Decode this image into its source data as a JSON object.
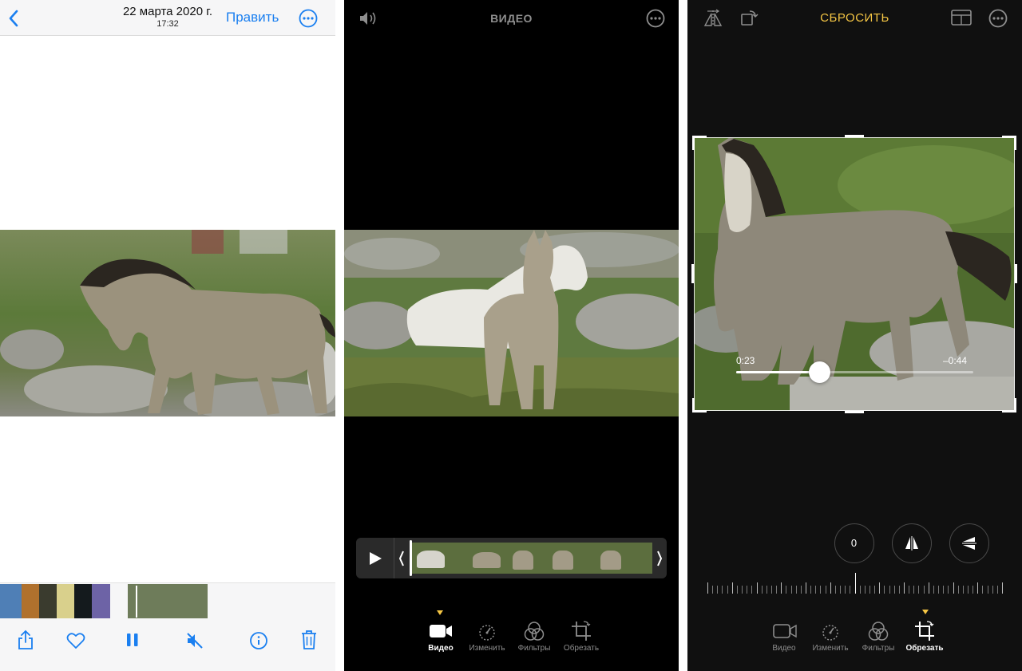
{
  "panel1": {
    "header": {
      "back_icon": "chevron-left-icon",
      "date": "22 марта 2020 г.",
      "time": "17:32",
      "edit_label": "Править",
      "more_icon": "ellipsis-circle-icon"
    },
    "toolbar": {
      "icons": [
        "share-icon",
        "heart-icon",
        "pause-icon",
        "speaker-mute-icon",
        "info-icon",
        "trash-icon"
      ]
    },
    "accent_color": "#1a7ff0"
  },
  "panel2": {
    "header": {
      "sound_icon": "speaker-icon",
      "title": "ВИДЕО",
      "more_icon": "ellipsis-circle-icon"
    },
    "timeline": {
      "play_icon": "play-icon"
    },
    "tabs": [
      {
        "label": "Видео",
        "icon": "video-camera-icon",
        "active": true
      },
      {
        "label": "Изменить",
        "icon": "adjust-dial-icon",
        "active": false
      },
      {
        "label": "Фильтры",
        "icon": "filters-icon",
        "active": false
      },
      {
        "label": "Обрезать",
        "icon": "crop-icon",
        "active": false
      }
    ]
  },
  "panel3": {
    "header": {
      "flip_icon": "flip-horizontal-icon",
      "rotate_icon": "rotate-icon",
      "reset_label": "СБРОСИТЬ",
      "aspect_icon": "aspect-ratio-icon",
      "more_icon": "ellipsis-circle-icon"
    },
    "scrubber": {
      "elapsed": "0:23",
      "remaining": "–0:44",
      "progress": 0.35
    },
    "straighten": {
      "value": "0"
    },
    "perspective_icons": [
      "vertical-perspective-icon",
      "horizontal-perspective-icon"
    ],
    "tabs": [
      {
        "label": "Видео",
        "icon": "video-camera-icon",
        "active": false
      },
      {
        "label": "Изменить",
        "icon": "adjust-dial-icon",
        "active": false
      },
      {
        "label": "Фильтры",
        "icon": "filters-icon",
        "active": false
      },
      {
        "label": "Обрезать",
        "icon": "crop-icon",
        "active": true
      }
    ],
    "accent_color": "#f5c644"
  }
}
